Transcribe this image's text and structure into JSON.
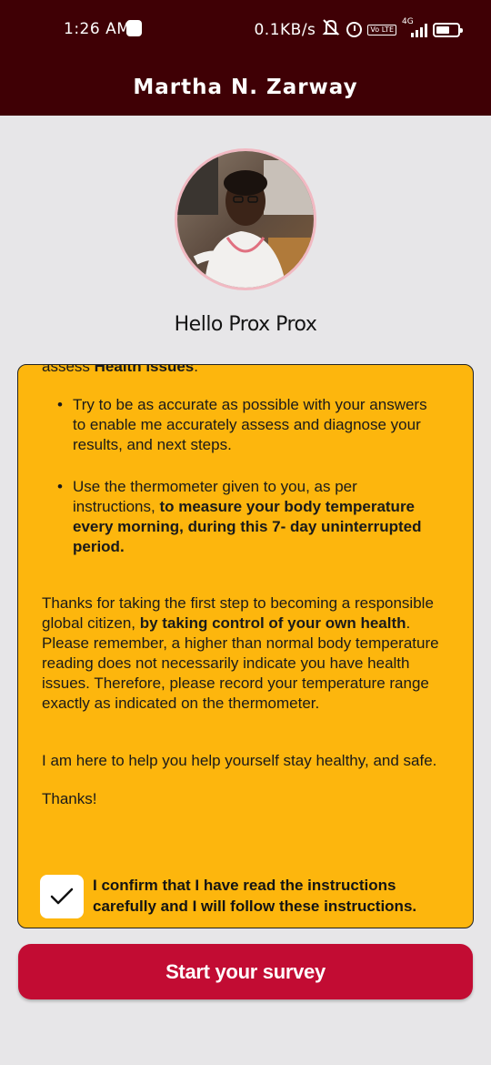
{
  "status_bar": {
    "time": "1:26 AM",
    "speed": "0.1KB/s",
    "network": "4G",
    "volte": "Vo LTE",
    "battery": "4"
  },
  "app_bar": {
    "title": "Martha N. Zarway"
  },
  "profile": {
    "avatar_alt": "Profile photo"
  },
  "greeting": "Hello Prox Prox",
  "instructions": {
    "cut_prefix": "assess ",
    "cut_bold": "Health issues",
    "cut_suffix": ".",
    "bullet1": "Try to be as accurate as possible with your answers to enable me accurately assess and diagnose your results, and next steps.",
    "bullet2_plain": "Use the thermometer given to you, as per instructions, ",
    "bullet2_bold": "to measure your body temperature every morning, during this 7- day uninterrupted period.",
    "para1_a": "Thanks for taking the first step to becoming a responsible global citizen, ",
    "para1_bold": "by taking control of your own health",
    "para1_b": ". Please remember, a higher than normal body temperature reading does not necessarily indicate you have health issues. Therefore, please record your temperature range exactly as indicated on the thermometer.",
    "para2": "I am here to help you help yourself stay healthy, and safe.",
    "para3": "Thanks!",
    "confirm_label": "I confirm that I have read the instructions carefully and I will follow these instructions.",
    "confirm_checked": true
  },
  "actions": {
    "start_label": "Start your survey"
  },
  "colors": {
    "header": "#3f0005",
    "panel": "#fdb60d",
    "button": "#c20c33",
    "background": "#e7e6e8"
  },
  "icons": [
    "mute-icon",
    "alarm-icon",
    "volte-icon",
    "signal-icon",
    "battery-icon",
    "check-icon"
  ]
}
